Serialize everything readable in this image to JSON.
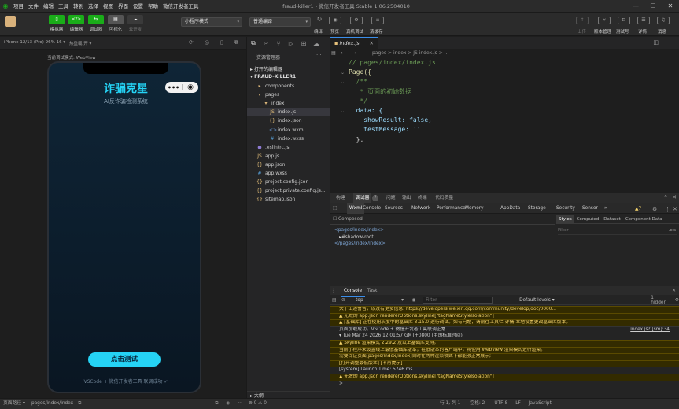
{
  "menu": [
    "项目",
    "文件",
    "编辑",
    "工具",
    "转到",
    "选择",
    "视图",
    "界面",
    "设置",
    "帮助",
    "微信开发者工具"
  ],
  "window_title": "fraud-killer1 - 微信开发者工具 Stable 1.06.2504010",
  "toolbar": {
    "simulator": "模拟器",
    "editor": "编辑器",
    "debugger": "调试器",
    "visual": "可视化",
    "cloud": "云开发",
    "mode_select": "小程序模式",
    "compile_select": "普通编译",
    "compile": "编译",
    "preview": "预览",
    "real_debug": "真机调试",
    "clear_cache": "清缓存",
    "upload": "上传",
    "version": "版本管理",
    "test": "测试号",
    "details": "详情",
    "messages": "消息"
  },
  "simulator": {
    "device": "iPhone 12/13 (Pro) 96% 16 ▾",
    "hot_reload": "热重载 开 ▾",
    "mode_label": "当前调试模式: WebView",
    "app_title": "诈骗克星",
    "app_subtitle": "AI反诈骗检测系统",
    "capsule_dots": "•••",
    "test_button": "点击测试",
    "footer": "VSCode + 微信开发者工具 联调成功 ✓"
  },
  "explorer": {
    "title": "资源管理器",
    "open_editors": "打开的编辑器",
    "project": "FRAUD-KILLER1",
    "outline": "大纲",
    "files": [
      {
        "name": "components",
        "icon": "▸",
        "indent": 1,
        "kind": "folder"
      },
      {
        "name": "pages",
        "icon": "▾",
        "indent": 1,
        "kind": "folder"
      },
      {
        "name": "index",
        "icon": "▾",
        "indent": 2,
        "kind": "folder"
      },
      {
        "name": "index.js",
        "icon": "JS",
        "indent": 3,
        "kind": "js",
        "selected": true
      },
      {
        "name": "index.json",
        "icon": "{}",
        "indent": 3,
        "kind": "json"
      },
      {
        "name": "index.wxml",
        "icon": "<>",
        "indent": 3,
        "kind": "wxml"
      },
      {
        "name": "index.wxss",
        "icon": "#",
        "indent": 3,
        "kind": "wxss"
      },
      {
        "name": ".eslintrc.js",
        "icon": "●",
        "indent": 1,
        "kind": "eslint"
      },
      {
        "name": "app.js",
        "icon": "JS",
        "indent": 1,
        "kind": "js"
      },
      {
        "name": "app.json",
        "icon": "{}",
        "indent": 1,
        "kind": "json"
      },
      {
        "name": "app.wxss",
        "icon": "#",
        "indent": 1,
        "kind": "wxss"
      },
      {
        "name": "project.config.json",
        "icon": "{}",
        "indent": 1,
        "kind": "json"
      },
      {
        "name": "project.private.config.js...",
        "icon": "{}",
        "indent": 1,
        "kind": "json"
      },
      {
        "name": "sitemap.json",
        "icon": "{}",
        "indent": 1,
        "kind": "json"
      }
    ]
  },
  "editor": {
    "tab": "index.js",
    "breadcrumb": "pages > index > JS index.js > ...",
    "lines": [
      {
        "text": "// pages/index/index.js",
        "color": "#6a9955"
      },
      {
        "text": "Page({",
        "color": "#dcdcaa"
      },
      {
        "text": "  /**",
        "color": "#6a9955"
      },
      {
        "text": "   * 页面的初始数据",
        "color": "#6a9955"
      },
      {
        "text": "   */",
        "color": "#6a9955"
      },
      {
        "text": "  data: {",
        "color": "#9cdcfe"
      },
      {
        "text": "    showResult: false,",
        "color": "#9cdcfe"
      },
      {
        "text": "    testMessage: ''",
        "color": "#9cdcfe"
      },
      {
        "text": "  },",
        "color": "#d4d4d4"
      },
      {
        "text": "",
        "color": "#d4d4d4"
      }
    ]
  },
  "devtools": {
    "top_tabs": [
      "构建",
      "调试器",
      "7",
      "问题",
      "输出",
      "终端",
      "代码质量"
    ],
    "panel_tabs": [
      "Wxml",
      "Console",
      "Sources",
      "Network",
      "Performance",
      "Memory",
      "AppData",
      "Storage",
      "Security",
      "Sensor",
      "»"
    ],
    "warn_count": "▲7",
    "composed": "Composed",
    "tree": [
      "<pages/index/index>",
      "▸#shadow-root",
      "</pages/index/index>"
    ],
    "styles_tabs": [
      "Styles",
      "Computed",
      "Dataset",
      "Component Data"
    ],
    "filter": "Filter",
    "cls": ".cls",
    "console_tabs": [
      "Console",
      "Task"
    ],
    "context": "top",
    "console_filter": "Filter",
    "levels": "Default levels ▾",
    "hidden": "1 hidden",
    "messages": [
      {
        "type": "warn",
        "text": "  大于上述警告，以及有更多信息: https://developers.weixin.qq.com/community/develop/doc/0000..."
      },
      {
        "type": "warn",
        "text": "▲ 无效的 app.json rendererOptions.skyline[\"tagNameStyleIsolation\"]"
      },
      {
        "type": "warn",
        "text": "▲ [基础库] 正在使用灰度中的基础库 3.15.0 进行调试。如有问题，请前往工具栏-详情-本地设置更改基础库版本。"
      },
      {
        "type": "info",
        "text": "  页面加载成功，VSCode + 微信开发者工具联调正常",
        "source": "index.js? [sm]:34"
      },
      {
        "type": "info",
        "text": "▾ Tue Mar 24 2026 12:01:57 GMT+0800 (中国标准时间)"
      },
      {
        "type": "warn",
        "text": "  ▲ Skyline 渲染模式 2.29.2 及以上基础库支持。"
      },
      {
        "type": "warn",
        "text": "      当前小程序未设置线上最低基础库版本，在低版本的客户端中，将使用 WebView 渲染模式进行渲染。"
      },
      {
        "type": "warn",
        "text": "      需要保证页面[pages/index/index]同时在两种渲染模式下都能够正常展示;"
      },
      {
        "type": "warn",
        "text": "      [打开调整最低版本]   [不再提示]"
      },
      {
        "type": "info",
        "text": "  [system] Launch Time: 5746 ms"
      },
      {
        "type": "warn",
        "text": "▲ 无效的 app.json rendererOptions.skyline[\"tagNameStyleIsolation\"]"
      },
      {
        "type": "info",
        "text": ">"
      }
    ]
  },
  "status": {
    "left": "页面路径 ▾",
    "path": "pages/index/index",
    "errors": "⊗ 0 ⚠ 0",
    "position": "行 1, 列 1",
    "spaces": "空格: 2",
    "encoding": "UTF-8",
    "eol": "LF",
    "lang": "JavaScript"
  }
}
